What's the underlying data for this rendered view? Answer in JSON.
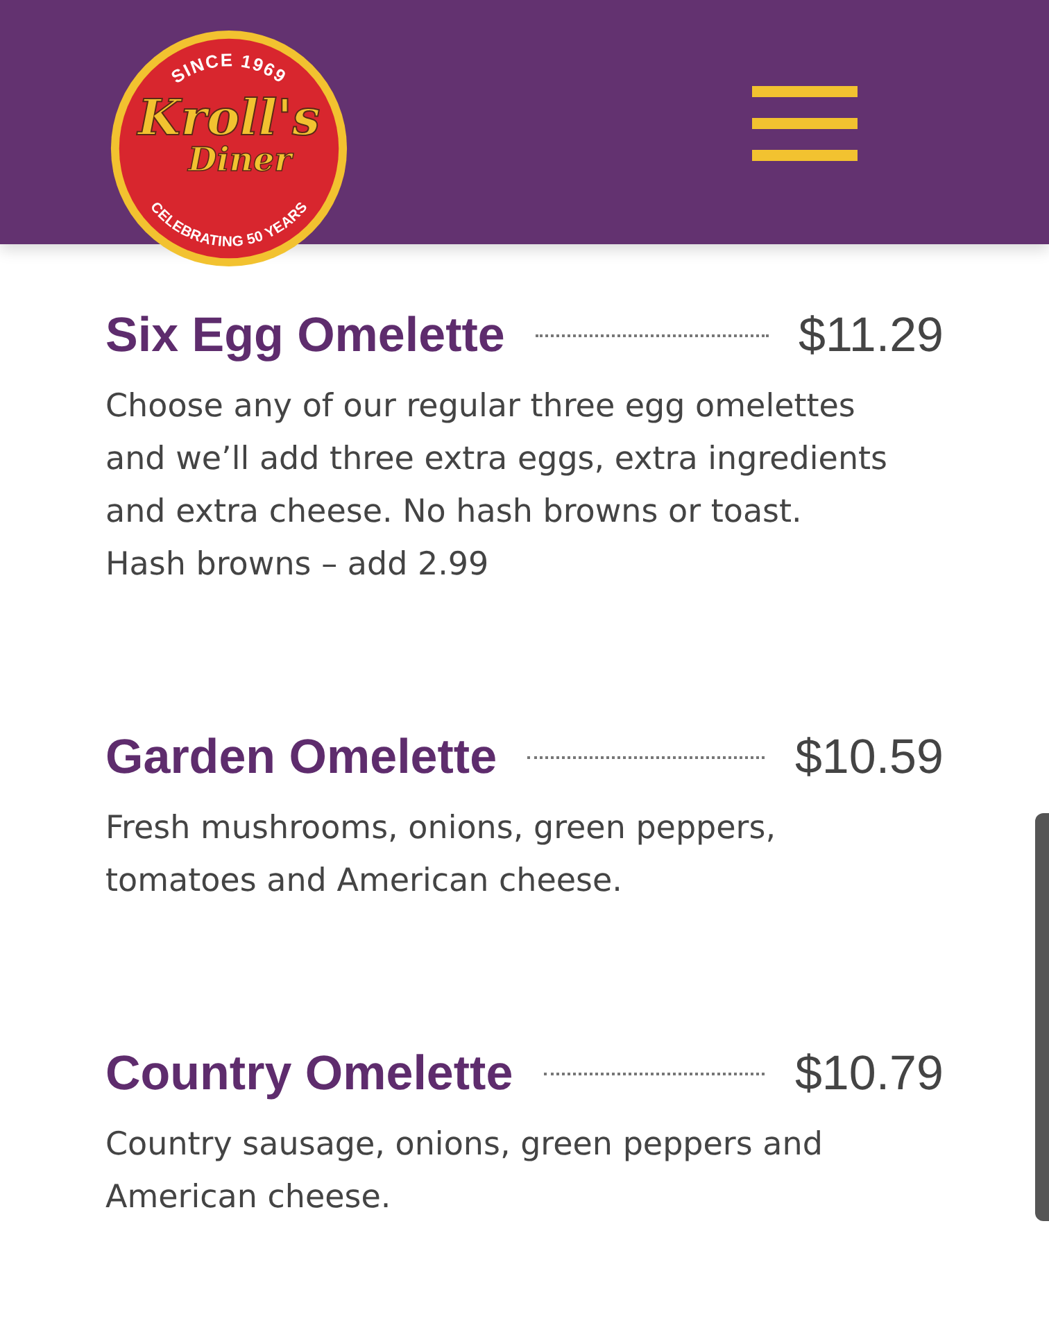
{
  "header": {
    "logo": {
      "top": "SINCE 1969",
      "name": "Kroll's",
      "sub": "Diner",
      "bottom": "CELEBRATING 50 YEARS"
    }
  },
  "items": [
    {
      "title": "Six Egg Omelette",
      "price": "$11.29",
      "description": "Choose any of our regular three egg omelettes and we’ll add three extra eggs, extra ingredients and extra cheese. No hash browns or toast. Hash browns – add 2.99"
    },
    {
      "title": "Garden Omelette",
      "price": "$10.59",
      "description": "Fresh mushrooms, onions, green peppers, tomatoes and American cheese."
    },
    {
      "title": "Country Omelette",
      "price": "$10.79",
      "description": "Country sausage, onions, green peppers and American cheese."
    }
  ]
}
